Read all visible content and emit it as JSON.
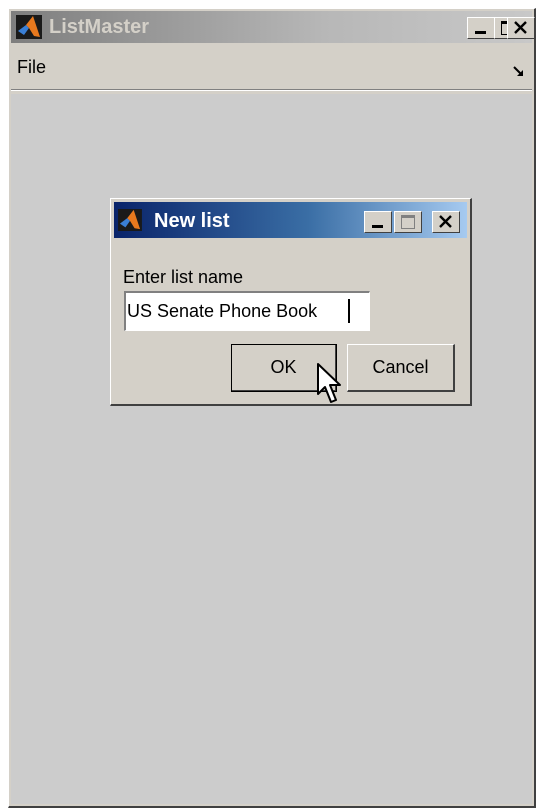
{
  "window": {
    "title": "ListMaster",
    "menu": {
      "file_label": "File"
    }
  },
  "dialog": {
    "title": "New list",
    "prompt": "Enter list name",
    "input_value": "US Senate Phone Book",
    "ok_label": "OK",
    "cancel_label": "Cancel"
  },
  "icons": {
    "app": "matlab-logo-icon",
    "minimize": "minimize-icon",
    "maximize": "maximize-icon",
    "close": "close-icon",
    "dock": "dock-arrow-icon",
    "cursor": "mouse-pointer-icon"
  },
  "colors": {
    "dialog_title_gradient_start": "#0a246a",
    "dialog_title_gradient_end": "#a6caf0",
    "inactive_title_gradient": "#7e7e7e",
    "window_face": "#d4d0c8",
    "figure_background": "#cccccc"
  }
}
